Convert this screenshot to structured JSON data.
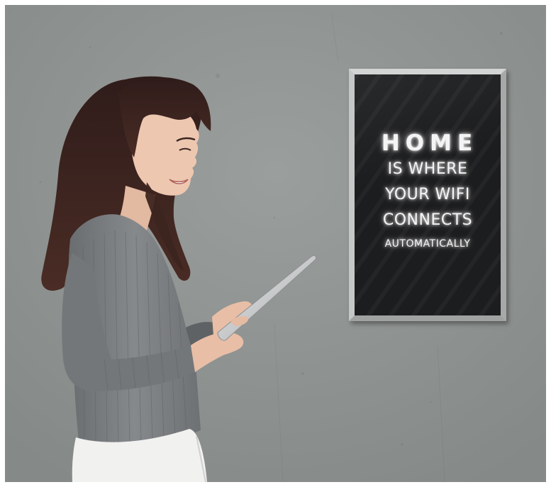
{
  "sign": {
    "line1": "HOME",
    "line2": "IS WHERE",
    "line3": "YOUR WIFI",
    "line4": "CONNECTS",
    "line5": "AUTOMATICALLY"
  },
  "colors": {
    "wall": "#8f9391",
    "sign_background": "#1c1d1e",
    "frame": "#b6b9b8",
    "sweater": "#777a7d",
    "hair": "#3a2320",
    "glow_text": "#f4f4f4"
  }
}
